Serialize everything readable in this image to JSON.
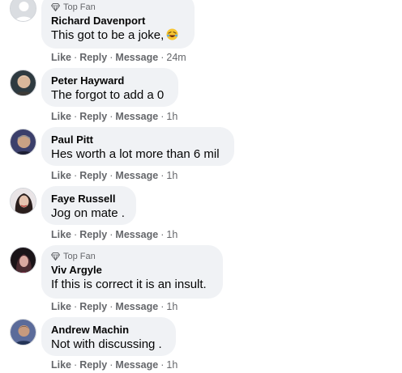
{
  "comments": [
    {
      "top_fan_label": "Top Fan",
      "name": "Richard Davenport",
      "text": "This got to be a joke,",
      "emoji_icon": "rolling-on-floor-laughing-emoji",
      "actions": {
        "like": "Like",
        "reply": "Reply",
        "message": "Message"
      },
      "time": "24m",
      "avatar": "default-profile-avatar"
    },
    {
      "name": "Peter Hayward",
      "text": "The forgot to add a 0",
      "actions": {
        "like": "Like",
        "reply": "Reply",
        "message": "Message"
      },
      "time": "1h"
    },
    {
      "name": "Paul Pitt",
      "text": "Hes worth a lot more than 6 mil",
      "actions": {
        "like": "Like",
        "reply": "Reply",
        "message": "Message"
      },
      "time": "1h"
    },
    {
      "name": "Faye Russell",
      "text": "Jog on mate .",
      "actions": {
        "like": "Like",
        "reply": "Reply",
        "message": "Message"
      },
      "time": "1h"
    },
    {
      "top_fan_label": "Top Fan",
      "name": "Viv Argyle",
      "text": "If this is correct it is an insult.",
      "actions": {
        "like": "Like",
        "reply": "Reply",
        "message": "Message"
      },
      "time": "1h"
    },
    {
      "name": "Andrew Machin",
      "text": "Not with discussing .",
      "actions": {
        "like": "Like",
        "reply": "Reply",
        "message": "Message"
      },
      "time": "1h"
    }
  ],
  "colors": {
    "bubble": "#f0f2f5",
    "secondary_text": "#65676b",
    "primary_text": "#050505"
  }
}
